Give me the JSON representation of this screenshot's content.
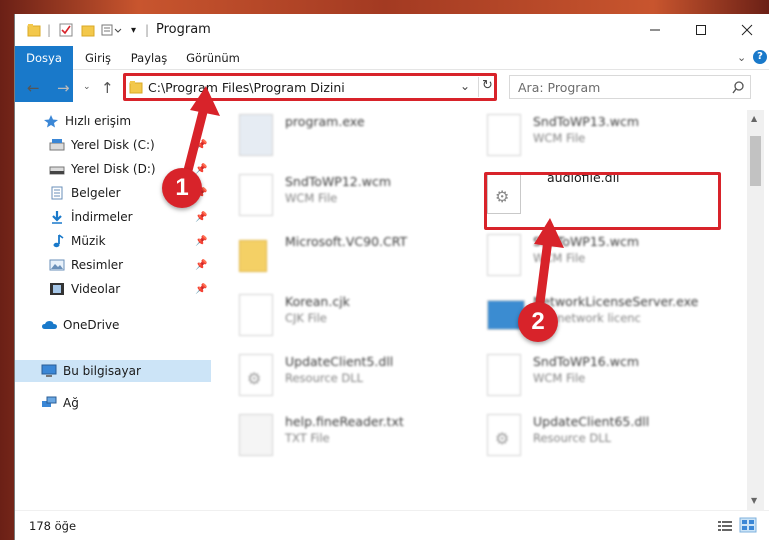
{
  "window": {
    "title": "Program"
  },
  "ribbon": {
    "tabs": [
      "Dosya",
      "Giriş",
      "Paylaş",
      "Görünüm"
    ]
  },
  "address": {
    "path": "C:\\Program Files\\Program Dizini"
  },
  "search": {
    "placeholder": "Ara: Program"
  },
  "sidebar": {
    "items": [
      {
        "label": "Hızlı erişim",
        "icon": "star-icon"
      },
      {
        "label": "Yerel Disk (C:)",
        "icon": "drive-icon"
      },
      {
        "label": "Yerel Disk (D:)",
        "icon": "drive-icon"
      },
      {
        "label": "Belgeler",
        "icon": "documents-icon"
      },
      {
        "label": "İndirmeler",
        "icon": "download-icon"
      },
      {
        "label": "Müzik",
        "icon": "music-icon"
      },
      {
        "label": "Resimler",
        "icon": "pictures-icon"
      },
      {
        "label": "Videolar",
        "icon": "videos-icon"
      },
      {
        "label": "OneDrive",
        "icon": "cloud-icon"
      },
      {
        "label": "Bu bilgisayar",
        "icon": "computer-icon"
      },
      {
        "label": "Ağ",
        "icon": "network-icon"
      }
    ]
  },
  "files": [
    {
      "name": "program.exe",
      "type": ""
    },
    {
      "name": "SndToWP13.wcm",
      "type": "WCM File"
    },
    {
      "name": "SndToWP12.wcm",
      "type": "WCM File"
    },
    {
      "name": "audiofile.dll",
      "type": ""
    },
    {
      "name": "Microsoft.VC90.CRT",
      "type": ""
    },
    {
      "name": "SndToWP15.wcm",
      "type": "WCM File"
    },
    {
      "name": "Korean.cjk",
      "type": "CJK File"
    },
    {
      "name": "NetworkLicenseServer.exe",
      "type": "TTF network licenc"
    },
    {
      "name": "UpdateClient5.dll",
      "type": "Resource DLL"
    },
    {
      "name": "SndToWP16.wcm",
      "type": "WCM File"
    },
    {
      "name": "help.fineReader.txt",
      "type": "TXT File"
    },
    {
      "name": "UpdateClient65.dll",
      "type": "Resource DLL"
    }
  ],
  "status": {
    "count": "178 öğe"
  },
  "annotations": {
    "badge1": "1",
    "badge2": "2"
  },
  "colors": {
    "accent": "#1979ca",
    "highlight": "#d8232a",
    "selection": "#cce4f7"
  }
}
